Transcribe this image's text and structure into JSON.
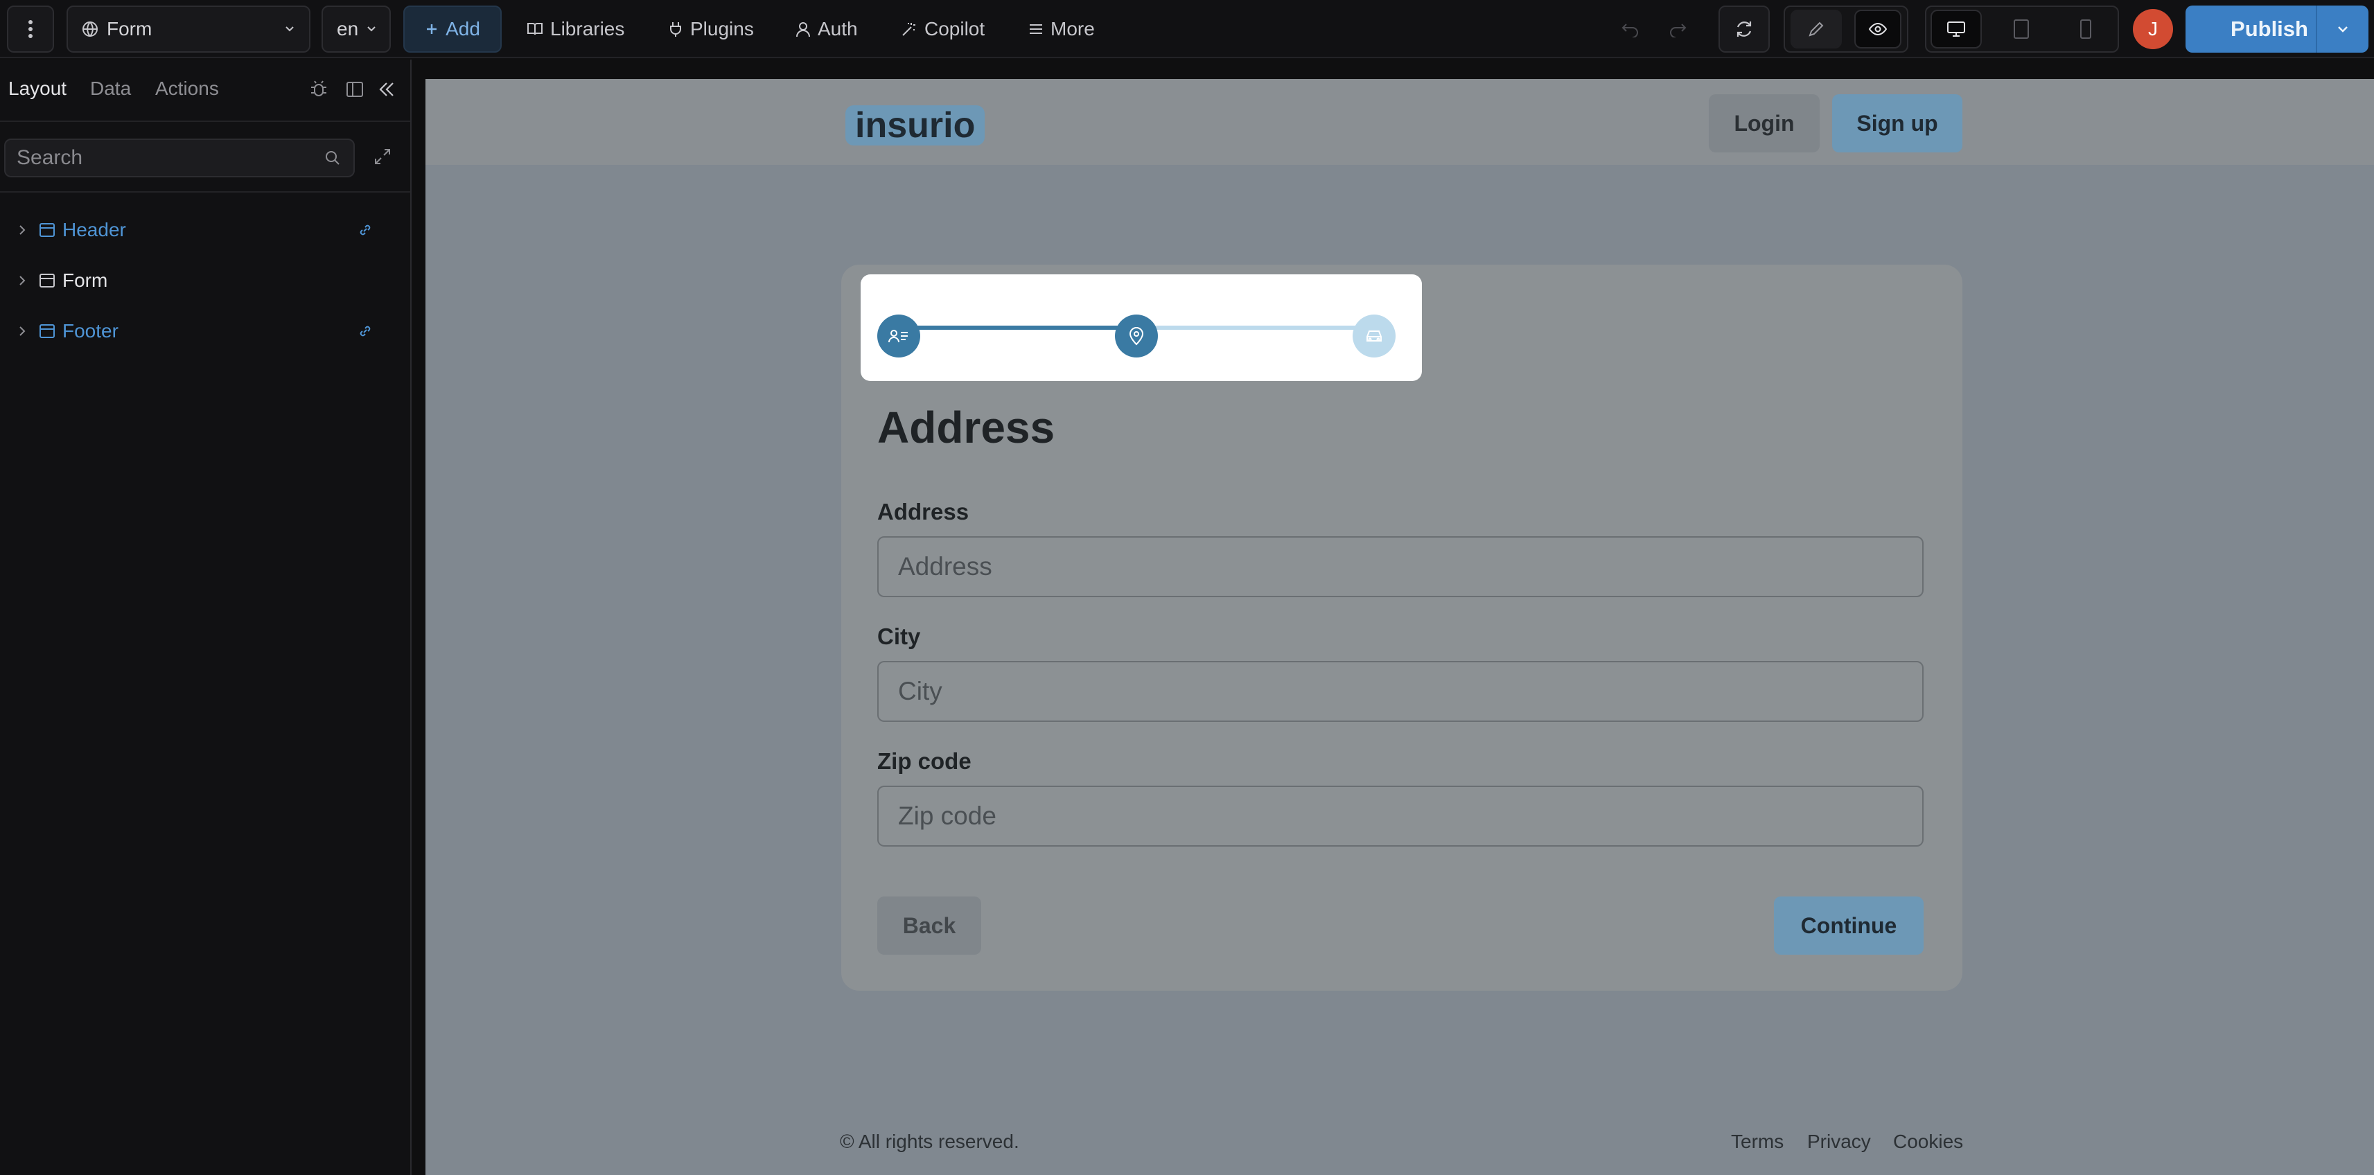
{
  "topbar": {
    "page_select": "Form",
    "lang_select": "en",
    "add_label": "Add",
    "libraries_label": "Libraries",
    "plugins_label": "Plugins",
    "auth_label": "Auth",
    "copilot_label": "Copilot",
    "more_label": "More",
    "avatar_initial": "J",
    "publish_label": "Publish"
  },
  "sidebar": {
    "tabs": [
      {
        "label": "Layout",
        "active": true
      },
      {
        "label": "Data",
        "active": false
      },
      {
        "label": "Actions",
        "active": false
      }
    ],
    "search_placeholder": "Search",
    "tree": [
      {
        "label": "Header",
        "linked": true
      },
      {
        "label": "Form",
        "linked": false
      },
      {
        "label": "Footer",
        "linked": true
      }
    ]
  },
  "site": {
    "logo": "insurio",
    "login_label": "Login",
    "signup_label": "Sign up",
    "stepper": {
      "steps": [
        "person-list-icon",
        "location-pin-icon",
        "car-icon"
      ],
      "current_step": 2,
      "total_steps": 3
    },
    "form_title": "Address",
    "fields": [
      {
        "label": "Address",
        "placeholder": "Address"
      },
      {
        "label": "City",
        "placeholder": "City"
      },
      {
        "label": "Zip code",
        "placeholder": "Zip code"
      }
    ],
    "back_label": "Back",
    "continue_label": "Continue",
    "footer": {
      "copyright": "© All rights reserved.",
      "links": [
        "Terms",
        "Privacy",
        "Cookies"
      ]
    }
  },
  "colors": {
    "accent": "#3b7fc4",
    "step_active": "#3a7aa3",
    "step_inactive": "#bcdaec",
    "avatar": "#d24b32"
  }
}
